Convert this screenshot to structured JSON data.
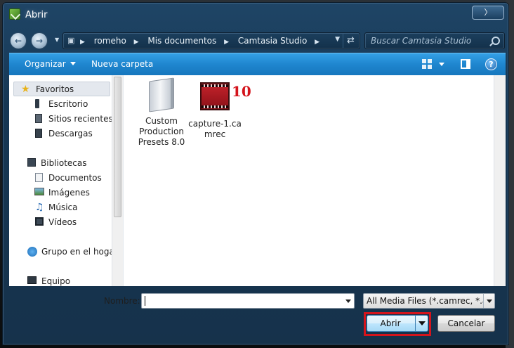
{
  "window": {
    "title": "Abrir"
  },
  "address_bar": {
    "crumbs": [
      "romeho",
      "Mis documentos",
      "Camtasia Studio"
    ]
  },
  "search": {
    "placeholder": "Buscar Camtasia Studio"
  },
  "toolbar": {
    "organize_label": "Organizar",
    "new_folder_label": "Nueva carpeta",
    "help_glyph": "?"
  },
  "nav_pane": {
    "favorites_label": "Favoritos",
    "favorites": [
      "Escritorio",
      "Sitios recientes",
      "Descargas"
    ],
    "libraries_label": "Bibliotecas",
    "libraries": [
      "Documentos",
      "Imágenes",
      "Música",
      "Vídeos"
    ],
    "homegroup_label": "Grupo en el hogar",
    "computer_label": "Equipo"
  },
  "files": [
    {
      "name": "Custom Production Presets 8.0",
      "icon": "folder-icon"
    },
    {
      "name": "capture-1.camrec",
      "icon": "camrec-file-icon"
    }
  ],
  "annotation": {
    "number": "10"
  },
  "bottom": {
    "name_label": "Nombre:",
    "name_value": "",
    "filter_value": "All Media Files (*.camrec, *.avi, *.",
    "open_label": "Abrir",
    "cancel_label": "Cancelar"
  },
  "colors": {
    "toolbar_blue": "#1f86cf",
    "highlight_red": "#d4141c",
    "frame_blue": "#163754"
  }
}
